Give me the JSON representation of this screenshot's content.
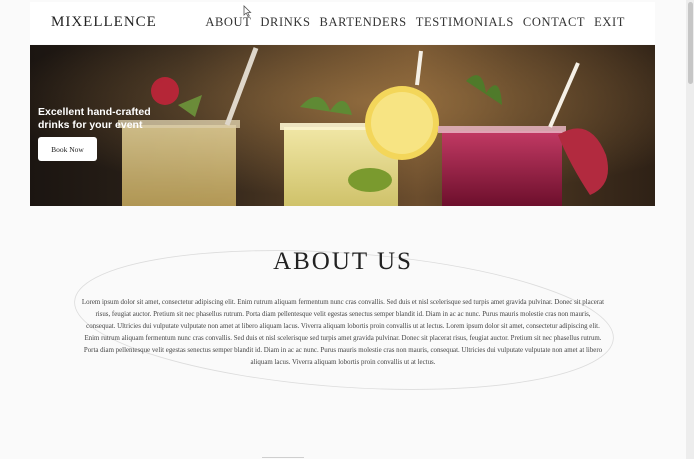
{
  "brand": "MIXELLENCE",
  "nav": {
    "items": [
      "ABOUT",
      "DRINKS",
      "BARTENDERS",
      "TESTIMONIALS",
      "CONTACT",
      "EXIT"
    ]
  },
  "hero": {
    "headline": "Excellent hand-crafted drinks for your event",
    "button": "Book Now"
  },
  "about": {
    "title": "ABOUT US",
    "body": "Lorem ipsum dolor sit amet, consectetur adipiscing elit. Enim rutrum aliquam fermentum nunc cras convallis. Sed duis et nisl scelerisque sed turpis amet gravida pulvinar. Donec sit placerat risus, feugiat auctor. Pretium sit nec phasellus rutrum. Porta diam pellentesque velit egestas senectus semper blandit id. Diam in ac ac nunc. Purus mauris molestie cras non mauris, consequat. Ultricies dui vulputate vulputate non amet at libero aliquam lacus. Viverra aliquam lobortis proin convallis ut at lectus. Lorem ipsum dolor sit amet, consectetur adipiscing elit. Enim rutrum aliquam fermentum nunc cras convallis. Sed duis et nisl scelerisque sed turpis amet gravida pulvinar. Donec sit placerat risus, feugiat auctor. Pretium sit nec phasellus rutrum. Porta diam pellentesque velit egestas senectus semper blandit id. Diam in ac ac nunc. Purus mauris molestie cras non mauris, consequat. Ultricies dui vulputate vulputate non amet at libero aliquam lacus. Viverra aliquam lobortis proin convallis ut at lectus."
  },
  "icons": {
    "cursor": "mouse-pointer-icon"
  }
}
